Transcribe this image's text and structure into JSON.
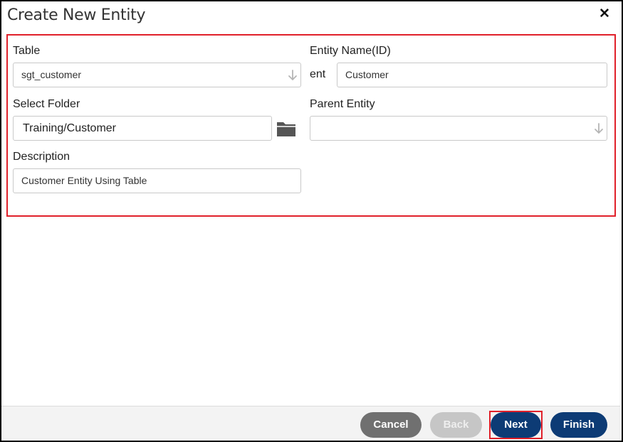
{
  "dialog": {
    "title": "Create New Entity",
    "close_icon": "close-icon"
  },
  "form": {
    "table": {
      "label": "Table",
      "value": "sgt_customer"
    },
    "entity_name": {
      "label": "Entity Name(ID)",
      "prefix": "ent",
      "value": "Customer"
    },
    "select_folder": {
      "label": "Select Folder",
      "value": "Training/Customer",
      "icon": "folder-icon"
    },
    "parent_entity": {
      "label": "Parent Entity",
      "value": ""
    },
    "description": {
      "label": "Description",
      "value": "Customer Entity Using Table"
    }
  },
  "footer": {
    "cancel_label": "Cancel",
    "back_label": "Back",
    "next_label": "Next",
    "finish_label": "Finish"
  },
  "colors": {
    "primary": "#0d3b75",
    "highlight": "#e0202a",
    "cancel": "#707070",
    "disabled": "#c6c6c6"
  }
}
